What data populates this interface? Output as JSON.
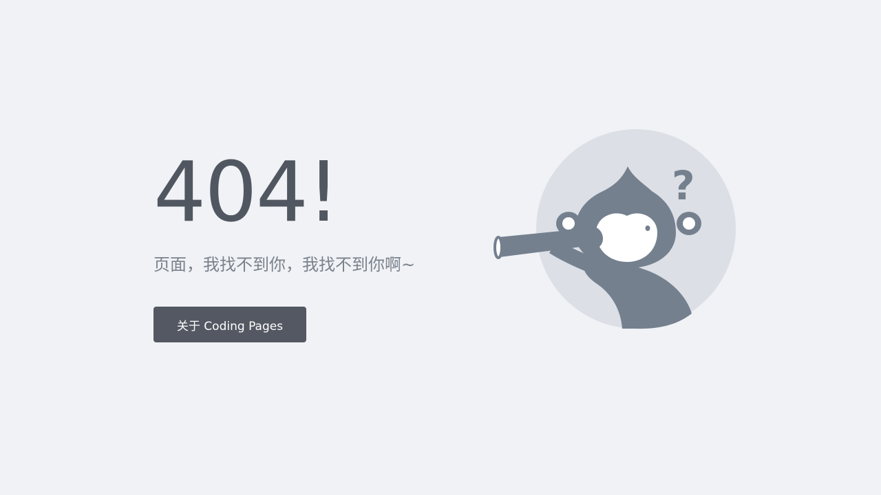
{
  "error": {
    "code": "404!",
    "message": "页面，我找不到你，我找不到你啊~"
  },
  "actions": {
    "about_label": "关于 Coding Pages"
  },
  "illustration": {
    "icon": "monkey-telescope-icon",
    "question_mark": "?"
  },
  "colors": {
    "background": "#f0f2f5",
    "title": "#515761",
    "message": "#7a818c",
    "button": "#535862",
    "illustration_circle": "#dcdfe5",
    "illustration_body": "#74808e"
  }
}
